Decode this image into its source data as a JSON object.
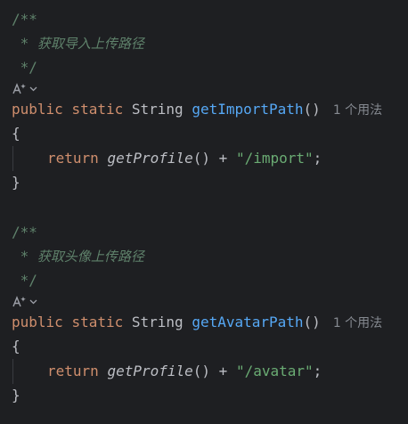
{
  "block1": {
    "comment_open": "/**",
    "comment_star": " * ",
    "comment_text": "获取导入上传路径",
    "comment_close": " */",
    "kw_public": "public",
    "kw_static": "static",
    "type": "String",
    "method": "getImportPath",
    "parens": "()",
    "usage_hint": "1 个用法",
    "open_brace": "{",
    "kw_return": "return",
    "call": "getProfile",
    "call_parens": "()",
    "plus": " + ",
    "string": "\"/import\"",
    "semicolon": ";",
    "close_brace": "}"
  },
  "block2": {
    "comment_open": "/**",
    "comment_star": " * ",
    "comment_text": "获取头像上传路径",
    "comment_close": " */",
    "kw_public": "public",
    "kw_static": "static",
    "type": "String",
    "method": "getAvatarPath",
    "parens": "()",
    "usage_hint": "1 个用法",
    "open_brace": "{",
    "kw_return": "return",
    "call": "getProfile",
    "call_parens": "()",
    "plus": " + ",
    "string": "\"/avatar\"",
    "semicolon": ";",
    "close_brace": "}"
  },
  "icons": {
    "ai_assistant": "ai-assistant-icon",
    "chevron": "chevron-down-icon"
  },
  "colors": {
    "background": "#1e1f22",
    "comment": "#5f826b",
    "keyword": "#cf8e6d",
    "method": "#56a8f5",
    "string": "#6aab73",
    "text": "#bcbec4",
    "hint": "#868a91"
  }
}
